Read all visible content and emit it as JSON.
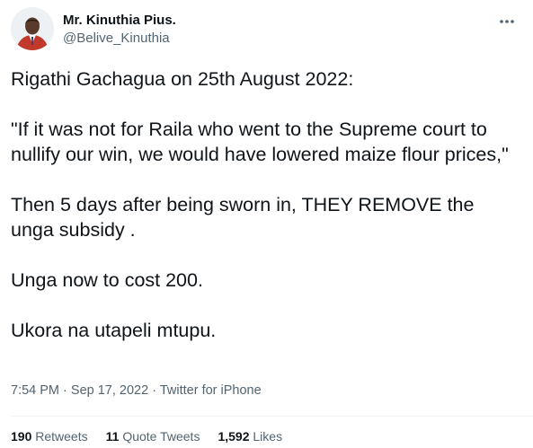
{
  "author": {
    "display_name": "Mr. Kinuthia Pius.",
    "handle": "@Belive_Kinuthia",
    "avatar_icon": "avatar-photo"
  },
  "more_icon": "more-dots-icon",
  "tweet": {
    "lines": [
      "Rigathi Gachagua on 25th August 2022:",
      "",
      "\"If it was not for Raila who went to the Supreme court to nullify our win, we would have lowered maize flour prices,\"",
      "",
      "Then 5 days after being sworn in, THEY REMOVE the unga subsidy .",
      "",
      "Unga now to cost 200.",
      "",
      "Ukora na utapeli mtupu."
    ]
  },
  "meta": {
    "time": "7:54 PM",
    "separator": "·",
    "date": "Sep 17, 2022",
    "source": "Twitter for iPhone"
  },
  "stats": {
    "retweets_count": "190",
    "retweets_label": "Retweets",
    "quotes_count": "11",
    "quotes_label": "Quote Tweets",
    "likes_count": "1,592",
    "likes_label": "Likes"
  },
  "colors": {
    "text_primary": "#0f1419",
    "text_secondary": "#536471",
    "divider": "#eff3f4",
    "avatar_suit": "#c0392b"
  }
}
